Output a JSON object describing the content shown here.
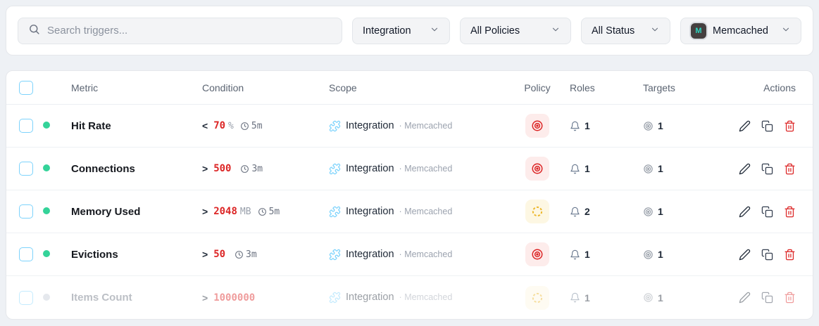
{
  "filters": {
    "search": {
      "placeholder": "Search triggers..."
    },
    "dropdowns": [
      {
        "label": "Integration"
      },
      {
        "label": "All Policies"
      },
      {
        "label": "All Status"
      },
      {
        "label": "Memcached",
        "icon": "memcached-logo",
        "icon_letter": "M"
      }
    ]
  },
  "table": {
    "columns": [
      "Metric",
      "Condition",
      "Scope",
      "Policy",
      "Roles",
      "Targets",
      "Actions"
    ],
    "scope_separator": "·",
    "rows": [
      {
        "metric": "Hit Rate",
        "active": true,
        "condition": {
          "operator": "<",
          "value": "70",
          "unit": "%",
          "window": "5m"
        },
        "scope": {
          "type": "Integration",
          "sub": "Memcached"
        },
        "policy": "critical",
        "roles": "1",
        "targets": "1"
      },
      {
        "metric": "Connections",
        "active": true,
        "condition": {
          "operator": ">",
          "value": "500",
          "unit": "",
          "window": "3m"
        },
        "scope": {
          "type": "Integration",
          "sub": "Memcached"
        },
        "policy": "critical",
        "roles": "1",
        "targets": "1"
      },
      {
        "metric": "Memory Used",
        "active": true,
        "condition": {
          "operator": ">",
          "value": "2048",
          "unit": "MB",
          "window": "5m"
        },
        "scope": {
          "type": "Integration",
          "sub": "Memcached"
        },
        "policy": "warning",
        "roles": "2",
        "targets": "1"
      },
      {
        "metric": "Evictions",
        "active": true,
        "condition": {
          "operator": ">",
          "value": "50",
          "unit": "",
          "window": "3m"
        },
        "scope": {
          "type": "Integration",
          "sub": "Memcached"
        },
        "policy": "critical",
        "roles": "1",
        "targets": "1"
      },
      {
        "metric": "Items Count",
        "active": false,
        "condition": {
          "operator": ">",
          "value": "1000000",
          "unit": "",
          "window": ""
        },
        "scope": {
          "type": "Integration",
          "sub": "Memcached"
        },
        "policy": "warning",
        "roles": "1",
        "targets": "1"
      }
    ]
  },
  "colors": {
    "critical": "#dc2626",
    "warning": "#ecb72a",
    "active_dot": "#34d399",
    "inactive_dot": "#c6ccd6",
    "checkbox_border": "#7dd3fc",
    "integration_icon": "#7dd3fc",
    "memcached_logo_bg": "#454040",
    "memcached_logo_fg": "#2dd4bf"
  }
}
